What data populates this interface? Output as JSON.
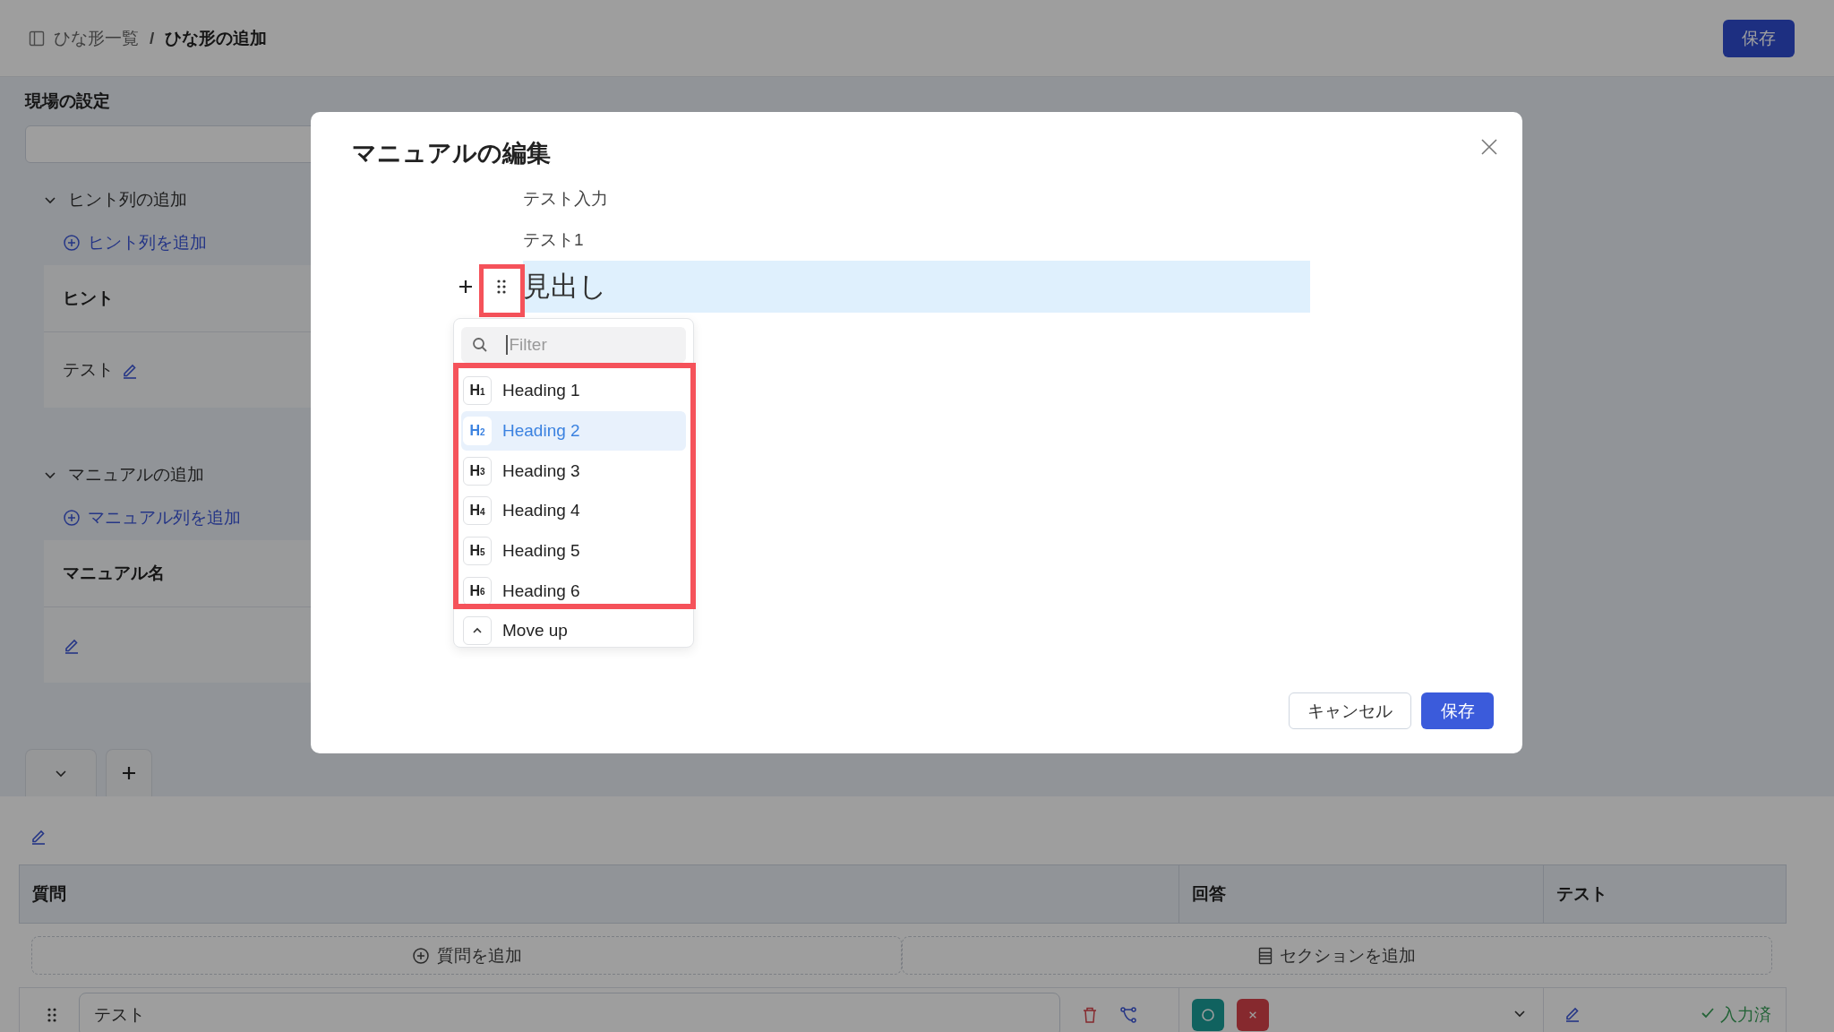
{
  "header": {
    "breadcrumb_parent": "ひな形一覧",
    "separator": "/",
    "breadcrumb_current": "ひな形の追加",
    "save_button": "保存"
  },
  "settings": {
    "title": "現場の設定",
    "sections": [
      {
        "title": "ヒント列の追加",
        "expanded": true,
        "add_link": "ヒント列を追加",
        "table_header": "ヒント",
        "rows": [
          {
            "kind": "text",
            "text": "テスト"
          }
        ]
      },
      {
        "title": "マニュアルの追加",
        "expanded": true,
        "add_link": "マニュアル列を追加",
        "table_header": "マニュアル名",
        "rows": [
          {
            "kind": "blank"
          }
        ]
      }
    ]
  },
  "questions": {
    "columns": [
      "質問",
      "回答",
      "テスト"
    ],
    "add_question": "質問を追加",
    "add_section": "セクションを追加",
    "rows": [
      {
        "text": "テスト",
        "answers": [
          {
            "kind": "circle"
          },
          {
            "kind": "cross"
          }
        ],
        "status": "入力済"
      }
    ]
  },
  "modal": {
    "title": "マニュアルの編集",
    "blocks": [
      {
        "kind": "paragraph",
        "text": "テスト入力",
        "selected": false
      },
      {
        "kind": "paragraph",
        "text": "テスト1",
        "selected": false
      },
      {
        "kind": "heading",
        "text": "見出し",
        "selected": true
      }
    ],
    "menu": {
      "filter_placeholder": "Filter",
      "items": [
        {
          "kind": "heading",
          "badge": "H$_{1}$",
          "label": "Heading 1",
          "selected": false
        },
        {
          "kind": "heading",
          "badge": "H$_{2}$",
          "label": "Heading 2",
          "selected": true
        },
        {
          "kind": "heading",
          "badge": "H$_{3}$",
          "label": "Heading 3",
          "selected": false
        },
        {
          "kind": "heading",
          "badge": "H$_{4}$",
          "label": "Heading 4",
          "selected": false
        },
        {
          "kind": "heading",
          "badge": "H$_{5}$",
          "label": "Heading 5",
          "selected": false
        },
        {
          "kind": "heading",
          "badge": "H$_{6}$",
          "label": "Heading 6",
          "selected": false
        },
        {
          "kind": "action",
          "label": "Move up",
          "selected": false
        }
      ]
    },
    "cancel_button": "キャンセル",
    "save_button": "保存"
  }
}
